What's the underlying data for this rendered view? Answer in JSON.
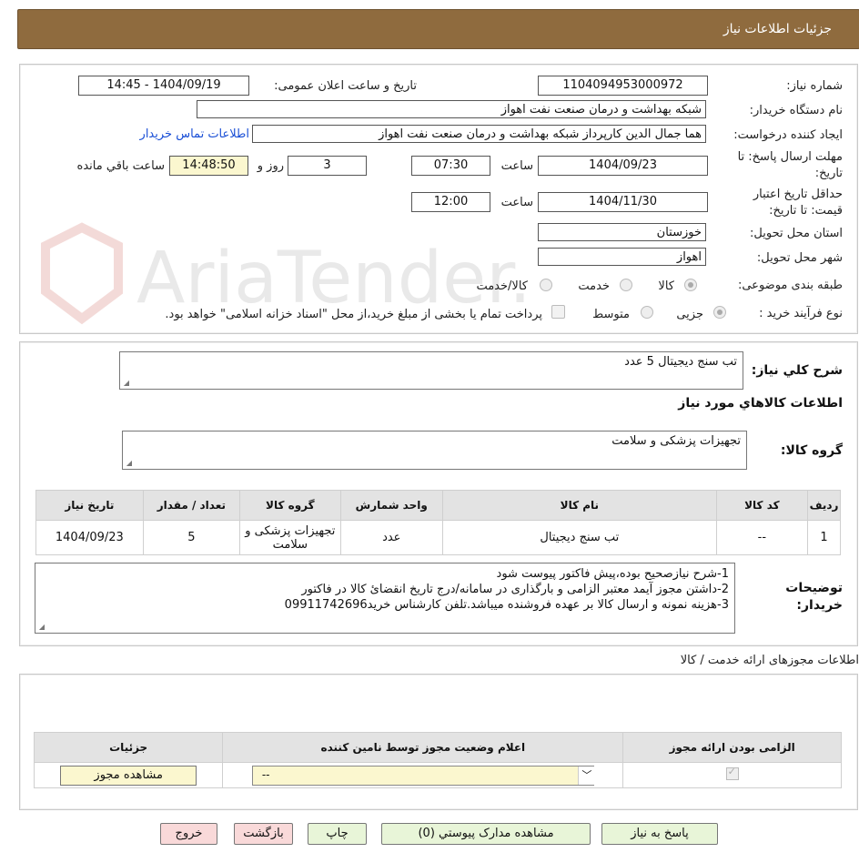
{
  "header": {
    "title": "جزئیات اطلاعات نیاز"
  },
  "info": {
    "need_number_label": "شماره نیاز:",
    "need_number": "1104094953000972",
    "announce_label": "تاریخ و ساعت اعلان عمومی:",
    "announce_value": "1404/09/19 - 14:45",
    "buyer_org_label": "نام دستگاه خریدار:",
    "buyer_org": "شبکه بهداشت و درمان صنعت نفت اهواز",
    "creator_label": "ایجاد کننده درخواست:",
    "creator": "هما جمال الدین کارپرداز شبکه بهداشت و درمان صنعت نفت اهواز",
    "contact_link": "اطلاعات تماس خریدار",
    "deadline_label_1": "مهلت ارسال پاسخ: تا",
    "deadline_label_2": "تاریخ:",
    "deadline_date": "1404/09/23",
    "time_label": "ساعت",
    "deadline_time": "07:30",
    "days_value": "3",
    "days_label": "روز و",
    "remaining_time": "14:48:50",
    "remaining_label": "ساعت باقي مانده",
    "validity_label_1": "حداقل تاریخ اعتبار",
    "validity_label_2": "قیمت: تا تاریخ:",
    "validity_date": "1404/11/30",
    "validity_time": "12:00",
    "province_label": "استان محل تحویل:",
    "province": "خوزستان",
    "city_label": "شهر محل تحویل:",
    "city": "اهواز",
    "category_label": "طبقه بندی موضوعی:",
    "category_options": [
      "کالا",
      "خدمت",
      "کالا/خدمت"
    ],
    "category_selected": "کالا",
    "process_label": "نوع فرآیند خرید :",
    "process_options": [
      "جزیی",
      "متوسط"
    ],
    "process_note": "پرداخت تمام یا بخشی از مبلغ خرید،از محل \"اسناد خزانه اسلامی\" خواهد بود."
  },
  "watermark_text": "AriaTender.neT",
  "details": {
    "general_desc_label": "شرح کلي نیاز:",
    "general_desc": "تب سنج دیجیتال 5 عدد",
    "goods_info_title": "اطلاعات کالاهاي مورد نیاز",
    "goods_group_label": "گروه کالا:",
    "goods_group": "تجهیزات پزشکی و سلامت",
    "table": {
      "headers": [
        "ردیف",
        "کد کالا",
        "نام کالا",
        "واحد شمارش",
        "گروه کالا",
        "تعداد / مقدار",
        "تاریخ نیاز"
      ],
      "rows": [
        [
          "1",
          "--",
          "تب سنج دیجیتال",
          "عدد",
          "تجهیزات پزشکی و سلامت",
          "5",
          "1404/09/23"
        ]
      ]
    },
    "buyer_notes_label_1": "توضیحات",
    "buyer_notes_label_2": "خریدار:",
    "buyer_notes": [
      "1-شرح نیازصحیح بوده،پیش فاکتور  پیوست شود",
      "2-داشتن مجوز آیمد معتبر الزامی و بارگذاری در سامانه/درج تاریخ انقضائ کالا در فاکتور",
      "3-هزینه نمونه و ارسال کالا بر عهده فروشنده میباشد.تلفن کارشناس خرید09911742696"
    ]
  },
  "permits": {
    "title": "اطلاعات مجوزهای ارائه خدمت / کالا",
    "headers": [
      "الزامی بودن ارائه مجوز",
      "اعلام وضعیت مجوز توسط نامین کننده",
      "جزئیات"
    ],
    "select_value": "--",
    "view_button": "مشاهده مجوز"
  },
  "buttons": {
    "reply": "پاسخ به نیاز",
    "attachments": "مشاهده مدارک پیوستي (0)",
    "print": "چاپ",
    "back": "بازگشت",
    "exit": "خروج"
  }
}
